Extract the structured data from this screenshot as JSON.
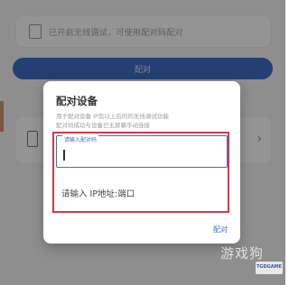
{
  "background": {
    "top_card": {
      "text": "已开启无线调试，可使用配对码配对"
    },
    "pair_button_label": "配对",
    "list_row": {},
    "accent_color": "#3f6fc4"
  },
  "dialog": {
    "title": "配对设备",
    "description_lines": [
      "用于配对设备 IP及以上后的的无线调试功能",
      "配对码成功与设备已主屏幕手动连接"
    ],
    "pairing_code_field": {
      "label": "请输入配对码",
      "value": ""
    },
    "address_field": {
      "placeholder": "请输入 IP地址:端口"
    },
    "confirm_button_label": "配对",
    "highlight_color": "#d5374b"
  },
  "watermark": {
    "text": "游戏狗",
    "logo_text": "TGDGAME"
  }
}
